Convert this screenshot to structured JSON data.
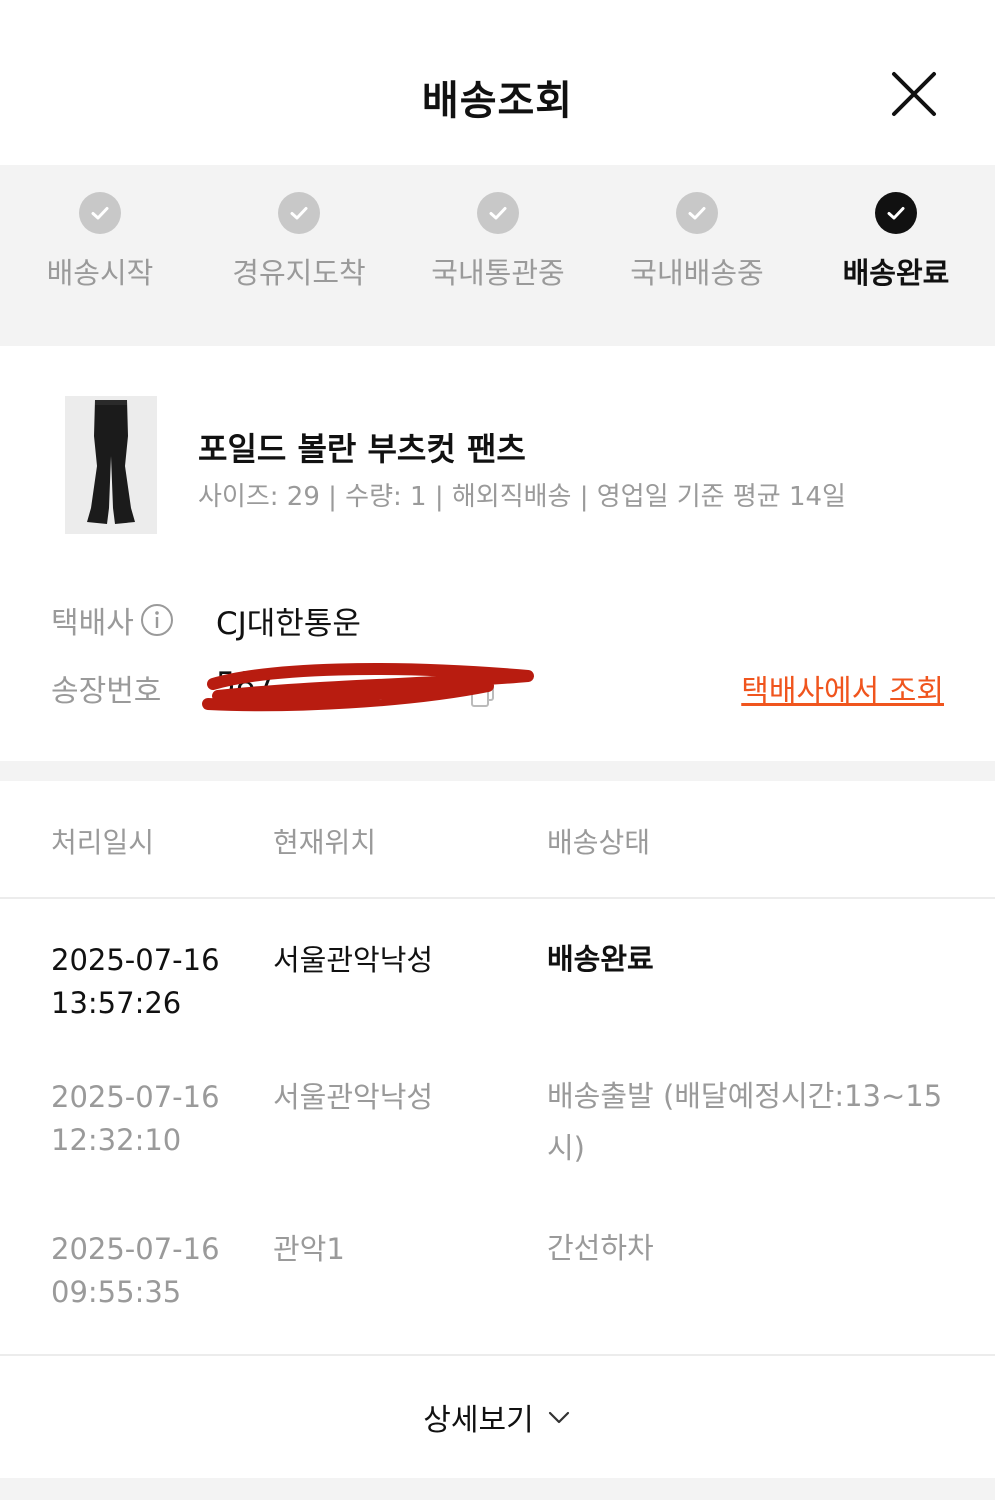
{
  "header": {
    "title": "배송조회"
  },
  "steps": [
    {
      "label": "배송시작",
      "done": true
    },
    {
      "label": "경유지도착",
      "done": true
    },
    {
      "label": "국내통관중",
      "done": true
    },
    {
      "label": "국내배송중",
      "done": true
    },
    {
      "label": "배송완료",
      "done": true,
      "current": true
    }
  ],
  "product": {
    "name": "포일드 볼란 부츠컷 팬츠",
    "meta": "사이즈: 29 | 수량: 1 | 해외직배송 | 영업일 기준 평균 14일"
  },
  "shipping": {
    "carrier_label": "택배사",
    "carrier_name": "CJ대한통운",
    "tracking_label": "송장번호",
    "tracking_number": "587",
    "carrier_link": "택배사에서 조회"
  },
  "history": {
    "columns": [
      "처리일시",
      "현재위치",
      "배송상태"
    ],
    "rows": [
      {
        "date": "2025-07-16",
        "time": "13:57:26",
        "location": "서울관악낙성",
        "status_line1": "배송완료",
        "status_line2": "",
        "current": true
      },
      {
        "date": "2025-07-16",
        "time": "12:32:10",
        "location": "서울관악낙성",
        "status_line1": "배송출발 (배달예정시간:13~15",
        "status_line2": "시)"
      },
      {
        "date": "2025-07-16",
        "time": "09:55:35",
        "location": "관악1",
        "status_line1": "간선하차",
        "status_line2": ""
      }
    ]
  },
  "footer": {
    "more_label": "상세보기"
  },
  "colors": {
    "accent": "#f0551e",
    "step_done": "#c8c8c8",
    "step_current": "#111111",
    "muted_text": "#9a9a9a",
    "band": "#f3f3f3",
    "redaction": "#b81c10"
  },
  "icons": {
    "close": "close-icon",
    "check": "check-icon",
    "info": "info-icon",
    "copy": "copy-icon",
    "chevron": "chevron-down-icon"
  }
}
